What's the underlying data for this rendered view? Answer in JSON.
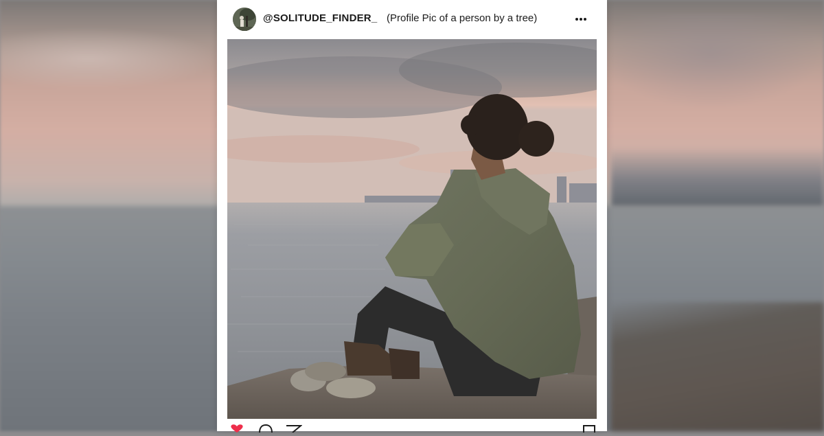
{
  "post": {
    "username": "@SOLITUDE_FINDER_",
    "caption_note": "(Profile Pic of a person by a tree)"
  },
  "icons": {
    "avatar": "avatar-image",
    "more": "more-options-icon",
    "like": "heart-icon",
    "comment": "comment-icon",
    "share": "send-icon",
    "save": "bookmark-icon"
  },
  "colors": {
    "like_red": "#ee2e4b",
    "hoodie": "#6b7058",
    "sky_pink": "#d8b4a6"
  }
}
